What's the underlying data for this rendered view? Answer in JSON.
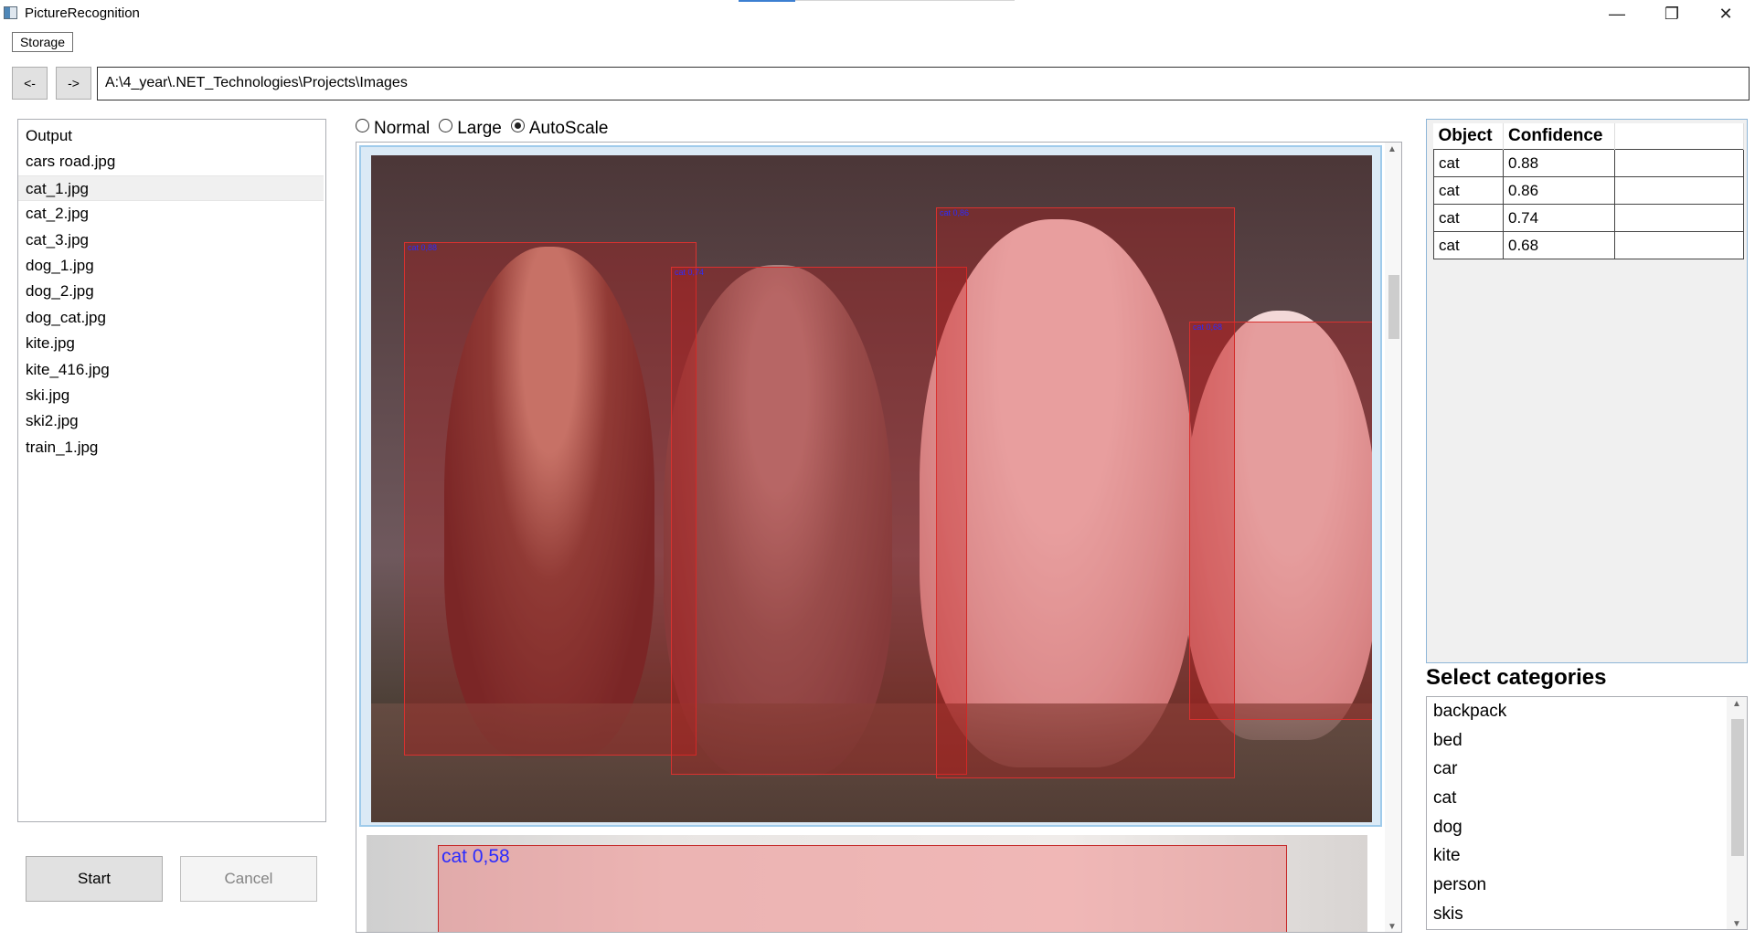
{
  "window": {
    "title": "PictureRecognition",
    "minimize_glyph": "—",
    "maximize_glyph": "❐",
    "close_glyph": "✕"
  },
  "menu": {
    "storage_label": "Storage"
  },
  "nav": {
    "back_label": "<-",
    "forward_label": "->",
    "path": "A:\\4_year\\.NET_Technologies\\Projects\\Images"
  },
  "files": [
    "Output",
    "cars road.jpg",
    "cat_1.jpg",
    "cat_2.jpg",
    "cat_3.jpg",
    "dog_1.jpg",
    "dog_2.jpg",
    "dog_cat.jpg",
    "kite.jpg",
    "kite_416.jpg",
    "ski.jpg",
    "ski2.jpg",
    "train_1.jpg"
  ],
  "selected_file": "cat_1.jpg",
  "actions": {
    "start_label": "Start",
    "cancel_label": "Cancel"
  },
  "scale_options": {
    "normal": "Normal",
    "large": "Large",
    "autoscale": "AutoScale",
    "selected": "AutoScale"
  },
  "main_image": {
    "detections": [
      {
        "label": "cat 0,88"
      },
      {
        "label": "cat 0,74"
      },
      {
        "label": "cat 0,86"
      },
      {
        "label": "cat 0,68"
      }
    ]
  },
  "next_image": {
    "label": "cat 0,58"
  },
  "results": {
    "headers": {
      "object": "Object",
      "confidence": "Confidence"
    },
    "rows": [
      {
        "object": "cat",
        "confidence": "0.88"
      },
      {
        "object": "cat",
        "confidence": "0.86"
      },
      {
        "object": "cat",
        "confidence": "0.74"
      },
      {
        "object": "cat",
        "confidence": "0.68"
      }
    ]
  },
  "categories": {
    "title": "Select categories",
    "items": [
      "backpack",
      "bed",
      "car",
      "cat",
      "dog",
      "kite",
      "person",
      "skis"
    ]
  },
  "colors": {
    "detection_box": "#d9312f",
    "detection_label": "#2b2bff",
    "selection_border": "#9fcbeb"
  }
}
